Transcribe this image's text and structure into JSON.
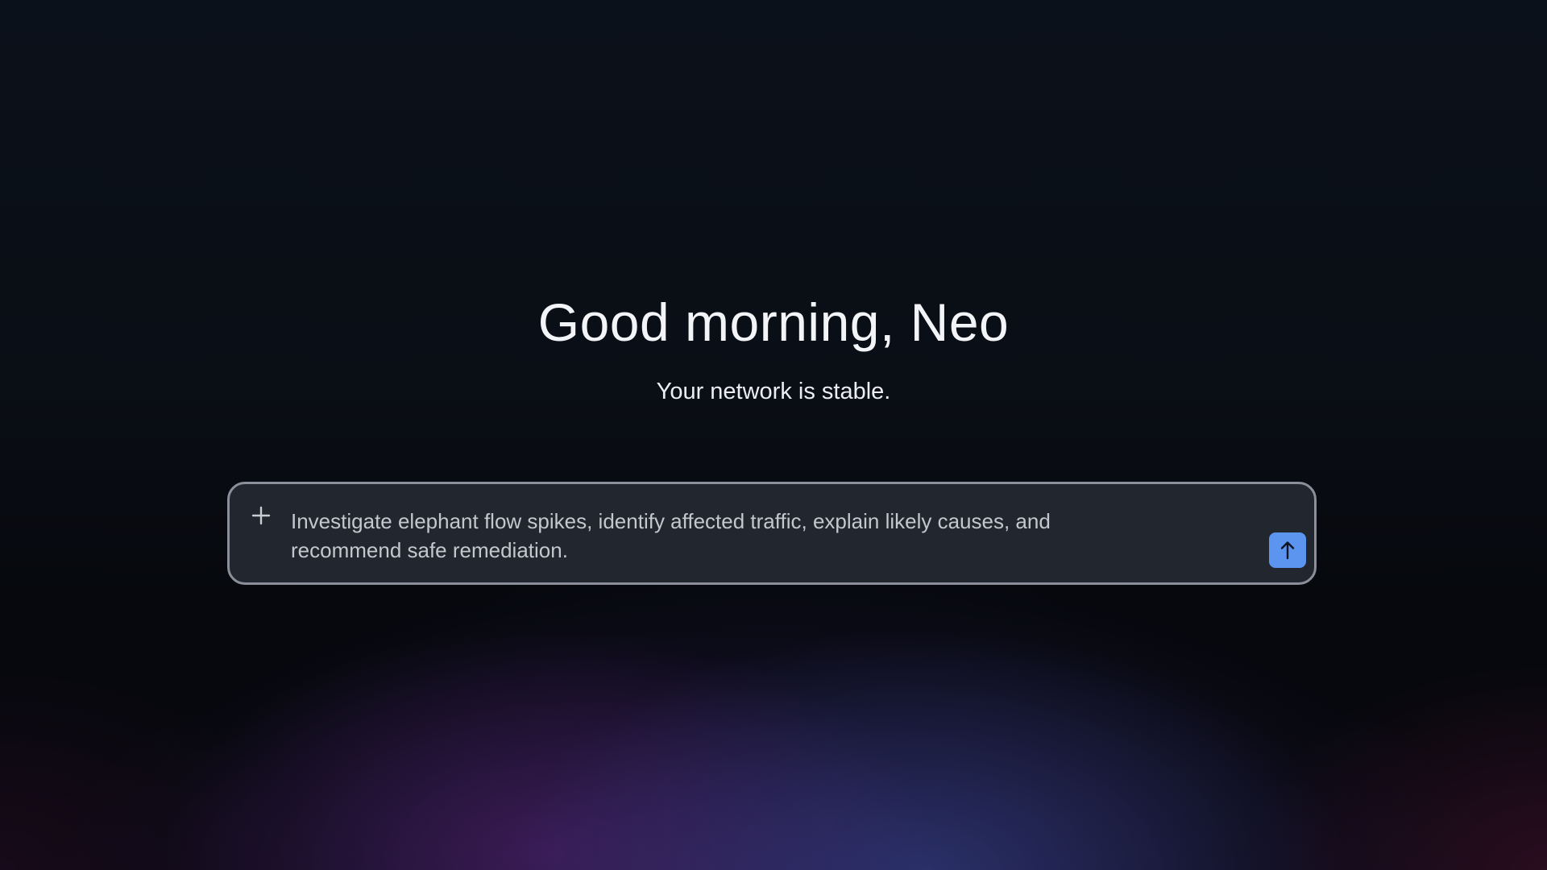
{
  "header": {
    "greeting": "Good morning, Neo",
    "status": "Your network is stable."
  },
  "prompt": {
    "value": "Investigate elephant flow spikes, identify affected traffic, explain likely causes, and recommend safe remediation.",
    "attach_icon": "plus-icon",
    "send_icon": "arrow-up-icon"
  },
  "colors": {
    "send_button": "#5b95f0",
    "input_background": "#22262e",
    "input_border": "#8a8f99"
  }
}
